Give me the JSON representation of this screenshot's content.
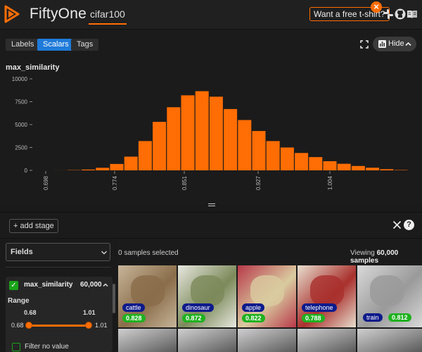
{
  "header": {
    "app_name": "FiftyOne",
    "dataset": "cifar100",
    "promo": "Want a free t-shirt?",
    "promo_close": "×",
    "icons": [
      "slack-icon",
      "github-icon",
      "book-icon"
    ]
  },
  "panel": {
    "tabs": [
      {
        "label": "Labels",
        "active": false
      },
      {
        "label": "Scalars",
        "active": true
      },
      {
        "label": "Tags",
        "active": false
      }
    ],
    "hide_label": "Hide",
    "field": "max_similarity"
  },
  "chart_data": {
    "type": "bar",
    "title": "max_similarity",
    "xlabel": "",
    "ylabel": "",
    "x_ticks": [
      "0.698",
      "0.774",
      "0.851",
      "0.927",
      "1.004"
    ],
    "y_ticks": [
      "0",
      "2500",
      "5000",
      "7500",
      "10000"
    ],
    "ylim": [
      0,
      10000
    ],
    "xlim": [
      0.698,
      1.004
    ],
    "color": "#ff6d04",
    "bins": [
      {
        "x": 0.7133,
        "value": 5
      },
      {
        "x": 0.7286,
        "value": 30
      },
      {
        "x": 0.7439,
        "value": 90
      },
      {
        "x": 0.7592,
        "value": 280
      },
      {
        "x": 0.7745,
        "value": 700
      },
      {
        "x": 0.7898,
        "value": 1500
      },
      {
        "x": 0.8051,
        "value": 3200
      },
      {
        "x": 0.8204,
        "value": 5300
      },
      {
        "x": 0.8357,
        "value": 6900
      },
      {
        "x": 0.851,
        "value": 8200
      },
      {
        "x": 0.8663,
        "value": 8650
      },
      {
        "x": 0.8816,
        "value": 8050
      },
      {
        "x": 0.8969,
        "value": 6700
      },
      {
        "x": 0.9122,
        "value": 5500
      },
      {
        "x": 0.9275,
        "value": 4300
      },
      {
        "x": 0.9428,
        "value": 3200
      },
      {
        "x": 0.9581,
        "value": 2500
      },
      {
        "x": 0.9734,
        "value": 1900
      },
      {
        "x": 0.9887,
        "value": 1450
      },
      {
        "x": 1.004,
        "value": 1000
      },
      {
        "x": 1.0193,
        "value": 720
      },
      {
        "x": 1.0346,
        "value": 480
      },
      {
        "x": 1.0499,
        "value": 290
      },
      {
        "x": 1.0652,
        "value": 130
      },
      {
        "x": 1.0805,
        "value": 40
      }
    ]
  },
  "viewbar": {
    "add_stage": "+ add stage",
    "help": "?"
  },
  "sidebar": {
    "fields_label": "Fields",
    "field_name": "max_similarity",
    "field_count": "60,000",
    "range_label": "Range",
    "range_min": "0.68",
    "range_max": "1.01",
    "track_min": "0.68",
    "track_max": "1.01",
    "filter_label": "Filter no value"
  },
  "grid": {
    "selected": "0 samples selected",
    "viewing_prefix": "Viewing",
    "viewing_count": "60,000 samples",
    "samples": [
      {
        "label": "cattle",
        "score": "0.828",
        "bg": "#8a6d4a",
        "accent": "#c7b59a"
      },
      {
        "label": "dinosaur",
        "score": "0.872",
        "bg": "#7c8a5a",
        "accent": "#e8e8e0"
      },
      {
        "label": "apple",
        "score": "0.822",
        "bg": "#d9cba0",
        "accent": "#b8394a"
      },
      {
        "label": "telephone",
        "score": "0.788",
        "bg": "#a9302d",
        "accent": "#e8dfcf"
      },
      {
        "label": "train",
        "score": "0.812",
        "bg": "#9a9a9a",
        "accent": "#d9d9d9"
      }
    ]
  }
}
